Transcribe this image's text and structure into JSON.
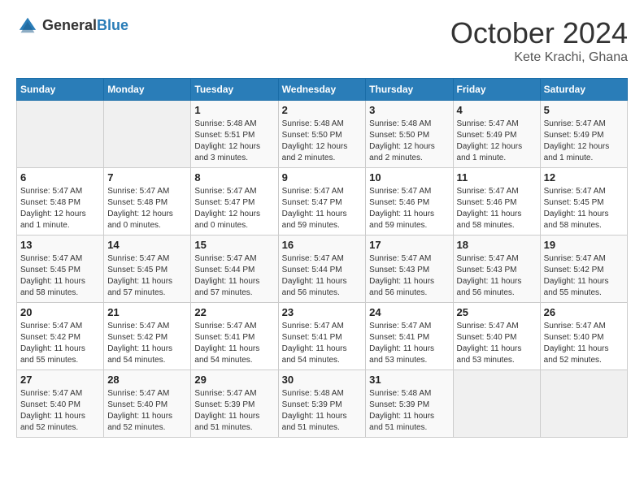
{
  "header": {
    "logo_general": "General",
    "logo_blue": "Blue",
    "month": "October 2024",
    "location": "Kete Krachi, Ghana"
  },
  "days_of_week": [
    "Sunday",
    "Monday",
    "Tuesday",
    "Wednesday",
    "Thursday",
    "Friday",
    "Saturday"
  ],
  "weeks": [
    [
      {
        "day": "",
        "sunrise": "",
        "sunset": "",
        "daylight": ""
      },
      {
        "day": "",
        "sunrise": "",
        "sunset": "",
        "daylight": ""
      },
      {
        "day": "1",
        "sunrise": "Sunrise: 5:48 AM",
        "sunset": "Sunset: 5:51 PM",
        "daylight": "Daylight: 12 hours and 3 minutes."
      },
      {
        "day": "2",
        "sunrise": "Sunrise: 5:48 AM",
        "sunset": "Sunset: 5:50 PM",
        "daylight": "Daylight: 12 hours and 2 minutes."
      },
      {
        "day": "3",
        "sunrise": "Sunrise: 5:48 AM",
        "sunset": "Sunset: 5:50 PM",
        "daylight": "Daylight: 12 hours and 2 minutes."
      },
      {
        "day": "4",
        "sunrise": "Sunrise: 5:47 AM",
        "sunset": "Sunset: 5:49 PM",
        "daylight": "Daylight: 12 hours and 1 minute."
      },
      {
        "day": "5",
        "sunrise": "Sunrise: 5:47 AM",
        "sunset": "Sunset: 5:49 PM",
        "daylight": "Daylight: 12 hours and 1 minute."
      }
    ],
    [
      {
        "day": "6",
        "sunrise": "Sunrise: 5:47 AM",
        "sunset": "Sunset: 5:48 PM",
        "daylight": "Daylight: 12 hours and 1 minute."
      },
      {
        "day": "7",
        "sunrise": "Sunrise: 5:47 AM",
        "sunset": "Sunset: 5:48 PM",
        "daylight": "Daylight: 12 hours and 0 minutes."
      },
      {
        "day": "8",
        "sunrise": "Sunrise: 5:47 AM",
        "sunset": "Sunset: 5:47 PM",
        "daylight": "Daylight: 12 hours and 0 minutes."
      },
      {
        "day": "9",
        "sunrise": "Sunrise: 5:47 AM",
        "sunset": "Sunset: 5:47 PM",
        "daylight": "Daylight: 11 hours and 59 minutes."
      },
      {
        "day": "10",
        "sunrise": "Sunrise: 5:47 AM",
        "sunset": "Sunset: 5:46 PM",
        "daylight": "Daylight: 11 hours and 59 minutes."
      },
      {
        "day": "11",
        "sunrise": "Sunrise: 5:47 AM",
        "sunset": "Sunset: 5:46 PM",
        "daylight": "Daylight: 11 hours and 58 minutes."
      },
      {
        "day": "12",
        "sunrise": "Sunrise: 5:47 AM",
        "sunset": "Sunset: 5:45 PM",
        "daylight": "Daylight: 11 hours and 58 minutes."
      }
    ],
    [
      {
        "day": "13",
        "sunrise": "Sunrise: 5:47 AM",
        "sunset": "Sunset: 5:45 PM",
        "daylight": "Daylight: 11 hours and 58 minutes."
      },
      {
        "day": "14",
        "sunrise": "Sunrise: 5:47 AM",
        "sunset": "Sunset: 5:45 PM",
        "daylight": "Daylight: 11 hours and 57 minutes."
      },
      {
        "day": "15",
        "sunrise": "Sunrise: 5:47 AM",
        "sunset": "Sunset: 5:44 PM",
        "daylight": "Daylight: 11 hours and 57 minutes."
      },
      {
        "day": "16",
        "sunrise": "Sunrise: 5:47 AM",
        "sunset": "Sunset: 5:44 PM",
        "daylight": "Daylight: 11 hours and 56 minutes."
      },
      {
        "day": "17",
        "sunrise": "Sunrise: 5:47 AM",
        "sunset": "Sunset: 5:43 PM",
        "daylight": "Daylight: 11 hours and 56 minutes."
      },
      {
        "day": "18",
        "sunrise": "Sunrise: 5:47 AM",
        "sunset": "Sunset: 5:43 PM",
        "daylight": "Daylight: 11 hours and 56 minutes."
      },
      {
        "day": "19",
        "sunrise": "Sunrise: 5:47 AM",
        "sunset": "Sunset: 5:42 PM",
        "daylight": "Daylight: 11 hours and 55 minutes."
      }
    ],
    [
      {
        "day": "20",
        "sunrise": "Sunrise: 5:47 AM",
        "sunset": "Sunset: 5:42 PM",
        "daylight": "Daylight: 11 hours and 55 minutes."
      },
      {
        "day": "21",
        "sunrise": "Sunrise: 5:47 AM",
        "sunset": "Sunset: 5:42 PM",
        "daylight": "Daylight: 11 hours and 54 minutes."
      },
      {
        "day": "22",
        "sunrise": "Sunrise: 5:47 AM",
        "sunset": "Sunset: 5:41 PM",
        "daylight": "Daylight: 11 hours and 54 minutes."
      },
      {
        "day": "23",
        "sunrise": "Sunrise: 5:47 AM",
        "sunset": "Sunset: 5:41 PM",
        "daylight": "Daylight: 11 hours and 54 minutes."
      },
      {
        "day": "24",
        "sunrise": "Sunrise: 5:47 AM",
        "sunset": "Sunset: 5:41 PM",
        "daylight": "Daylight: 11 hours and 53 minutes."
      },
      {
        "day": "25",
        "sunrise": "Sunrise: 5:47 AM",
        "sunset": "Sunset: 5:40 PM",
        "daylight": "Daylight: 11 hours and 53 minutes."
      },
      {
        "day": "26",
        "sunrise": "Sunrise: 5:47 AM",
        "sunset": "Sunset: 5:40 PM",
        "daylight": "Daylight: 11 hours and 52 minutes."
      }
    ],
    [
      {
        "day": "27",
        "sunrise": "Sunrise: 5:47 AM",
        "sunset": "Sunset: 5:40 PM",
        "daylight": "Daylight: 11 hours and 52 minutes."
      },
      {
        "day": "28",
        "sunrise": "Sunrise: 5:47 AM",
        "sunset": "Sunset: 5:40 PM",
        "daylight": "Daylight: 11 hours and 52 minutes."
      },
      {
        "day": "29",
        "sunrise": "Sunrise: 5:47 AM",
        "sunset": "Sunset: 5:39 PM",
        "daylight": "Daylight: 11 hours and 51 minutes."
      },
      {
        "day": "30",
        "sunrise": "Sunrise: 5:48 AM",
        "sunset": "Sunset: 5:39 PM",
        "daylight": "Daylight: 11 hours and 51 minutes."
      },
      {
        "day": "31",
        "sunrise": "Sunrise: 5:48 AM",
        "sunset": "Sunset: 5:39 PM",
        "daylight": "Daylight: 11 hours and 51 minutes."
      },
      {
        "day": "",
        "sunrise": "",
        "sunset": "",
        "daylight": ""
      },
      {
        "day": "",
        "sunrise": "",
        "sunset": "",
        "daylight": ""
      }
    ]
  ]
}
